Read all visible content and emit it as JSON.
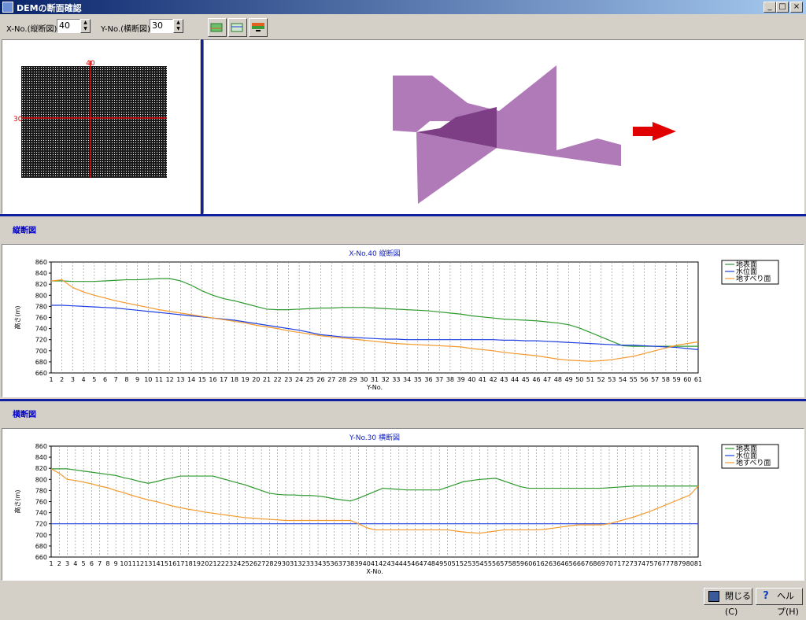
{
  "window": {
    "title": "DEMの断面確認"
  },
  "controls": {
    "x_label": "X-No.(縦断図)",
    "x_value": "40",
    "y_label": "Y-No.(横断図)",
    "y_value": "30"
  },
  "map": {
    "x_marker": "40",
    "y_marker": "30"
  },
  "sections": {
    "longitudinal": "縦断図",
    "cross": "横断図"
  },
  "buttons": {
    "close": "閉じる(C)",
    "help": "ヘルプ(H)"
  },
  "colors": {
    "ground": "#2e9a2e",
    "water": "#1f3fe0",
    "slip": "#f39a2e",
    "surface3d": "#b07ab8",
    "arrow": "#e00000"
  },
  "chart_data": [
    {
      "type": "line",
      "title": "X-No.40 縦断図",
      "xlabel": "Y-No.",
      "ylabel": "高さ(m)",
      "ylim": [
        660,
        860
      ],
      "yticks": [
        660,
        680,
        700,
        720,
        740,
        760,
        780,
        800,
        820,
        840,
        860
      ],
      "x": [
        1,
        2,
        3,
        4,
        5,
        6,
        7,
        8,
        9,
        10,
        11,
        12,
        13,
        14,
        15,
        16,
        17,
        18,
        19,
        20,
        21,
        22,
        23,
        24,
        25,
        26,
        27,
        28,
        29,
        30,
        31,
        32,
        33,
        34,
        35,
        36,
        37,
        38,
        39,
        40,
        41,
        42,
        43,
        44,
        45,
        46,
        47,
        48,
        49,
        50,
        51,
        52,
        53,
        54,
        55,
        56,
        57,
        58,
        59,
        60,
        61
      ],
      "legend_position": "right",
      "series": [
        {
          "name": "地表面",
          "values": [
            826,
            826,
            825,
            825,
            825,
            826,
            827,
            828,
            828,
            829,
            830,
            830,
            826,
            818,
            808,
            800,
            794,
            790,
            785,
            780,
            775,
            774,
            774,
            775,
            776,
            777,
            777,
            778,
            778,
            778,
            777,
            776,
            775,
            774,
            773,
            772,
            770,
            768,
            766,
            763,
            761,
            759,
            757,
            756,
            755,
            754,
            752,
            750,
            747,
            741,
            733,
            725,
            717,
            709,
            708,
            708,
            708,
            708,
            708,
            708,
            708
          ]
        },
        {
          "name": "水位面",
          "values": [
            782,
            782,
            781,
            780,
            779,
            778,
            777,
            775,
            773,
            771,
            769,
            767,
            765,
            763,
            761,
            759,
            757,
            755,
            752,
            749,
            746,
            743,
            740,
            737,
            733,
            729,
            727,
            725,
            724,
            723,
            722,
            721,
            721,
            720,
            720,
            720,
            720,
            720,
            720,
            720,
            720,
            720,
            719,
            719,
            718,
            718,
            717,
            716,
            715,
            714,
            713,
            712,
            711,
            710,
            710,
            709,
            708,
            707,
            706,
            704,
            702
          ]
        },
        {
          "name": "地すべり面",
          "values": [
            826,
            828,
            814,
            806,
            800,
            795,
            790,
            786,
            782,
            778,
            774,
            771,
            768,
            765,
            762,
            759,
            756,
            753,
            750,
            746,
            743,
            740,
            736,
            733,
            730,
            727,
            725,
            723,
            721,
            719,
            717,
            715,
            713,
            712,
            711,
            710,
            709,
            708,
            707,
            704,
            702,
            700,
            697,
            695,
            693,
            691,
            688,
            685,
            683,
            682,
            681,
            682,
            684,
            687,
            690,
            695,
            700,
            705,
            710,
            713,
            716
          ]
        }
      ]
    },
    {
      "type": "line",
      "title": "Y-No.30 横断図",
      "xlabel": "X-No.",
      "ylabel": "高さ(m)",
      "ylim": [
        660,
        860
      ],
      "yticks": [
        660,
        680,
        700,
        720,
        740,
        760,
        780,
        800,
        820,
        840,
        860
      ],
      "x": [
        1,
        2,
        3,
        4,
        5,
        6,
        7,
        8,
        9,
        10,
        11,
        12,
        13,
        14,
        15,
        16,
        17,
        18,
        19,
        20,
        21,
        22,
        23,
        24,
        25,
        26,
        27,
        28,
        29,
        30,
        31,
        32,
        33,
        34,
        35,
        36,
        37,
        38,
        39,
        40,
        41,
        42,
        43,
        44,
        45,
        46,
        47,
        48,
        49,
        50,
        51,
        52,
        53,
        54,
        55,
        56,
        57,
        58,
        59,
        60,
        61,
        62,
        63,
        64,
        65,
        66,
        67,
        68,
        69,
        70,
        71,
        72,
        73,
        74,
        75,
        76,
        77,
        78,
        79,
        80,
        81
      ],
      "legend_position": "right",
      "series": [
        {
          "name": "地表面",
          "values": [
            819,
            819,
            819,
            817,
            815,
            813,
            811,
            809,
            807,
            803,
            800,
            796,
            793,
            796,
            800,
            803,
            806,
            806,
            806,
            806,
            806,
            802,
            798,
            794,
            790,
            785,
            780,
            775,
            773,
            772,
            772,
            771,
            771,
            770,
            768,
            765,
            763,
            761,
            766,
            772,
            778,
            784,
            783,
            782,
            781,
            781,
            781,
            781,
            781,
            786,
            791,
            796,
            798,
            800,
            801,
            802,
            797,
            792,
            787,
            784,
            784,
            784,
            784,
            784,
            784,
            784,
            784,
            784,
            784,
            785,
            786,
            787,
            788,
            788,
            788,
            788,
            788,
            788,
            788,
            788,
            788
          ]
        },
        {
          "name": "水位面",
          "values": [
            720,
            720,
            720,
            720,
            720,
            720,
            720,
            720,
            720,
            720,
            720,
            720,
            720,
            720,
            720,
            720,
            720,
            720,
            720,
            720,
            720,
            720,
            720,
            720,
            720,
            720,
            720,
            720,
            720,
            720,
            720,
            720,
            720,
            720,
            720,
            720,
            720,
            720,
            720,
            720,
            720,
            720,
            720,
            720,
            720,
            720,
            720,
            720,
            720,
            720,
            720,
            720,
            720,
            720,
            720,
            720,
            720,
            720,
            720,
            720,
            720,
            720,
            720,
            720,
            720,
            720,
            720,
            720,
            720,
            720,
            720,
            720,
            720,
            720,
            720,
            720,
            720,
            720,
            720,
            720,
            720
          ]
        },
        {
          "name": "地すべり面",
          "values": [
            819,
            811,
            800,
            798,
            795,
            792,
            788,
            785,
            780,
            776,
            771,
            767,
            763,
            760,
            756,
            752,
            749,
            746,
            744,
            741,
            739,
            737,
            735,
            733,
            731,
            730,
            729,
            728,
            727,
            726,
            726,
            726,
            726,
            726,
            726,
            726,
            726,
            726,
            720,
            713,
            709,
            709,
            709,
            709,
            709,
            709,
            709,
            709,
            709,
            709,
            707,
            705,
            704,
            703,
            705,
            707,
            709,
            709,
            709,
            709,
            709,
            710,
            712,
            714,
            716,
            718,
            718,
            718,
            718,
            720,
            724,
            728,
            732,
            737,
            742,
            748,
            754,
            760,
            766,
            772,
            788
          ]
        }
      ]
    }
  ]
}
